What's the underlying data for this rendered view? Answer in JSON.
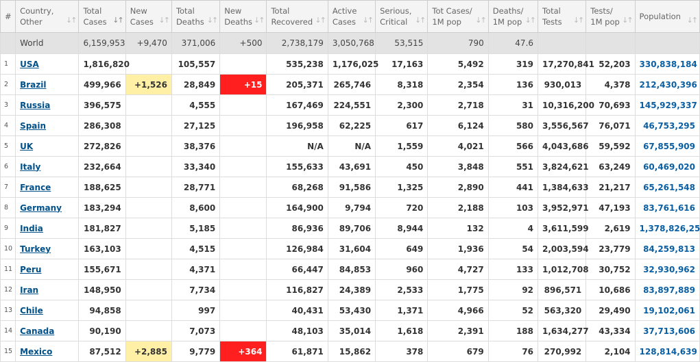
{
  "headers": [
    {
      "line1": "#",
      "line2": ""
    },
    {
      "line1": "Country,",
      "line2": "Other"
    },
    {
      "line1": "Total",
      "line2": "Cases"
    },
    {
      "line1": "New",
      "line2": "Cases"
    },
    {
      "line1": "Total",
      "line2": "Deaths"
    },
    {
      "line1": "New",
      "line2": "Deaths"
    },
    {
      "line1": "Total",
      "line2": "Recovered"
    },
    {
      "line1": "Active",
      "line2": "Cases"
    },
    {
      "line1": "Serious,",
      "line2": "Critical"
    },
    {
      "line1": "Tot Cases/",
      "line2": "1M pop"
    },
    {
      "line1": "Deaths/",
      "line2": "1M pop"
    },
    {
      "line1": "Total",
      "line2": "Tests"
    },
    {
      "line1": "Tests/",
      "line2": "1M pop"
    },
    {
      "line1": "Population",
      "line2": ""
    }
  ],
  "sort_icon": "sort-arrows-icon",
  "world": {
    "country": "World",
    "total_cases": "6,159,953",
    "new_cases": "+9,470",
    "total_deaths": "371,006",
    "new_deaths": "+500",
    "total_recovered": "2,738,179",
    "active_cases": "3,050,768",
    "serious": "53,515",
    "cases_per_1m": "790",
    "deaths_per_1m": "47.6",
    "total_tests": "",
    "tests_per_1m": "",
    "population": ""
  },
  "rows": [
    {
      "num": "1",
      "country": "USA",
      "total_cases": "1,816,820",
      "new_cases": "",
      "total_deaths": "105,557",
      "new_deaths": "",
      "total_recovered": "535,238",
      "active_cases": "1,176,025",
      "serious": "17,163",
      "cases_per_1m": "5,492",
      "deaths_per_1m": "319",
      "total_tests": "17,270,841",
      "tests_per_1m": "52,203",
      "population": "330,838,184"
    },
    {
      "num": "2",
      "country": "Brazil",
      "total_cases": "499,966",
      "new_cases": "+1,526",
      "total_deaths": "28,849",
      "new_deaths": "+15",
      "total_recovered": "205,371",
      "active_cases": "265,746",
      "serious": "8,318",
      "cases_per_1m": "2,354",
      "deaths_per_1m": "136",
      "total_tests": "930,013",
      "tests_per_1m": "4,378",
      "population": "212,430,396"
    },
    {
      "num": "3",
      "country": "Russia",
      "total_cases": "396,575",
      "new_cases": "",
      "total_deaths": "4,555",
      "new_deaths": "",
      "total_recovered": "167,469",
      "active_cases": "224,551",
      "serious": "2,300",
      "cases_per_1m": "2,718",
      "deaths_per_1m": "31",
      "total_tests": "10,316,200",
      "tests_per_1m": "70,693",
      "population": "145,929,337"
    },
    {
      "num": "4",
      "country": "Spain",
      "total_cases": "286,308",
      "new_cases": "",
      "total_deaths": "27,125",
      "new_deaths": "",
      "total_recovered": "196,958",
      "active_cases": "62,225",
      "serious": "617",
      "cases_per_1m": "6,124",
      "deaths_per_1m": "580",
      "total_tests": "3,556,567",
      "tests_per_1m": "76,071",
      "population": "46,753,295"
    },
    {
      "num": "5",
      "country": "UK",
      "total_cases": "272,826",
      "new_cases": "",
      "total_deaths": "38,376",
      "new_deaths": "",
      "total_recovered": "N/A",
      "active_cases": "N/A",
      "serious": "1,559",
      "cases_per_1m": "4,021",
      "deaths_per_1m": "566",
      "total_tests": "4,043,686",
      "tests_per_1m": "59,592",
      "population": "67,855,909"
    },
    {
      "num": "6",
      "country": "Italy",
      "total_cases": "232,664",
      "new_cases": "",
      "total_deaths": "33,340",
      "new_deaths": "",
      "total_recovered": "155,633",
      "active_cases": "43,691",
      "serious": "450",
      "cases_per_1m": "3,848",
      "deaths_per_1m": "551",
      "total_tests": "3,824,621",
      "tests_per_1m": "63,249",
      "population": "60,469,020"
    },
    {
      "num": "7",
      "country": "France",
      "total_cases": "188,625",
      "new_cases": "",
      "total_deaths": "28,771",
      "new_deaths": "",
      "total_recovered": "68,268",
      "active_cases": "91,586",
      "serious": "1,325",
      "cases_per_1m": "2,890",
      "deaths_per_1m": "441",
      "total_tests": "1,384,633",
      "tests_per_1m": "21,217",
      "population": "65,261,548"
    },
    {
      "num": "8",
      "country": "Germany",
      "total_cases": "183,294",
      "new_cases": "",
      "total_deaths": "8,600",
      "new_deaths": "",
      "total_recovered": "164,900",
      "active_cases": "9,794",
      "serious": "720",
      "cases_per_1m": "2,188",
      "deaths_per_1m": "103",
      "total_tests": "3,952,971",
      "tests_per_1m": "47,193",
      "population": "83,761,616"
    },
    {
      "num": "9",
      "country": "India",
      "total_cases": "181,827",
      "new_cases": "",
      "total_deaths": "5,185",
      "new_deaths": "",
      "total_recovered": "86,936",
      "active_cases": "89,706",
      "serious": "8,944",
      "cases_per_1m": "132",
      "deaths_per_1m": "4",
      "total_tests": "3,611,599",
      "tests_per_1m": "2,619",
      "population": "1,378,826,256"
    },
    {
      "num": "10",
      "country": "Turkey",
      "total_cases": "163,103",
      "new_cases": "",
      "total_deaths": "4,515",
      "new_deaths": "",
      "total_recovered": "126,984",
      "active_cases": "31,604",
      "serious": "649",
      "cases_per_1m": "1,936",
      "deaths_per_1m": "54",
      "total_tests": "2,003,594",
      "tests_per_1m": "23,779",
      "population": "84,259,813"
    },
    {
      "num": "11",
      "country": "Peru",
      "total_cases": "155,671",
      "new_cases": "",
      "total_deaths": "4,371",
      "new_deaths": "",
      "total_recovered": "66,447",
      "active_cases": "84,853",
      "serious": "960",
      "cases_per_1m": "4,727",
      "deaths_per_1m": "133",
      "total_tests": "1,012,708",
      "tests_per_1m": "30,752",
      "population": "32,930,962"
    },
    {
      "num": "12",
      "country": "Iran",
      "total_cases": "148,950",
      "new_cases": "",
      "total_deaths": "7,734",
      "new_deaths": "",
      "total_recovered": "116,827",
      "active_cases": "24,389",
      "serious": "2,533",
      "cases_per_1m": "1,775",
      "deaths_per_1m": "92",
      "total_tests": "896,571",
      "tests_per_1m": "10,686",
      "population": "83,897,889"
    },
    {
      "num": "13",
      "country": "Chile",
      "total_cases": "94,858",
      "new_cases": "",
      "total_deaths": "997",
      "new_deaths": "",
      "total_recovered": "40,431",
      "active_cases": "53,430",
      "serious": "1,371",
      "cases_per_1m": "4,966",
      "deaths_per_1m": "52",
      "total_tests": "563,320",
      "tests_per_1m": "29,490",
      "population": "19,102,061"
    },
    {
      "num": "14",
      "country": "Canada",
      "total_cases": "90,190",
      "new_cases": "",
      "total_deaths": "7,073",
      "new_deaths": "",
      "total_recovered": "48,103",
      "active_cases": "35,014",
      "serious": "1,618",
      "cases_per_1m": "2,391",
      "deaths_per_1m": "188",
      "total_tests": "1,634,277",
      "tests_per_1m": "43,334",
      "population": "37,713,606"
    },
    {
      "num": "15",
      "country": "Mexico",
      "total_cases": "87,512",
      "new_cases": "+2,885",
      "total_deaths": "9,779",
      "new_deaths": "+364",
      "total_recovered": "61,871",
      "active_cases": "15,862",
      "serious": "378",
      "cases_per_1m": "679",
      "deaths_per_1m": "76",
      "total_tests": "270,992",
      "tests_per_1m": "2,104",
      "population": "128,814,639"
    }
  ],
  "colors": {
    "header_bg": "#f4f4f4",
    "world_row_bg": "#e3e3e3",
    "new_cases_highlight": "#fff0a6",
    "new_deaths_highlight": "#ff1f1f",
    "country_link": "#00508a",
    "population_link": "#0a5fa3"
  }
}
